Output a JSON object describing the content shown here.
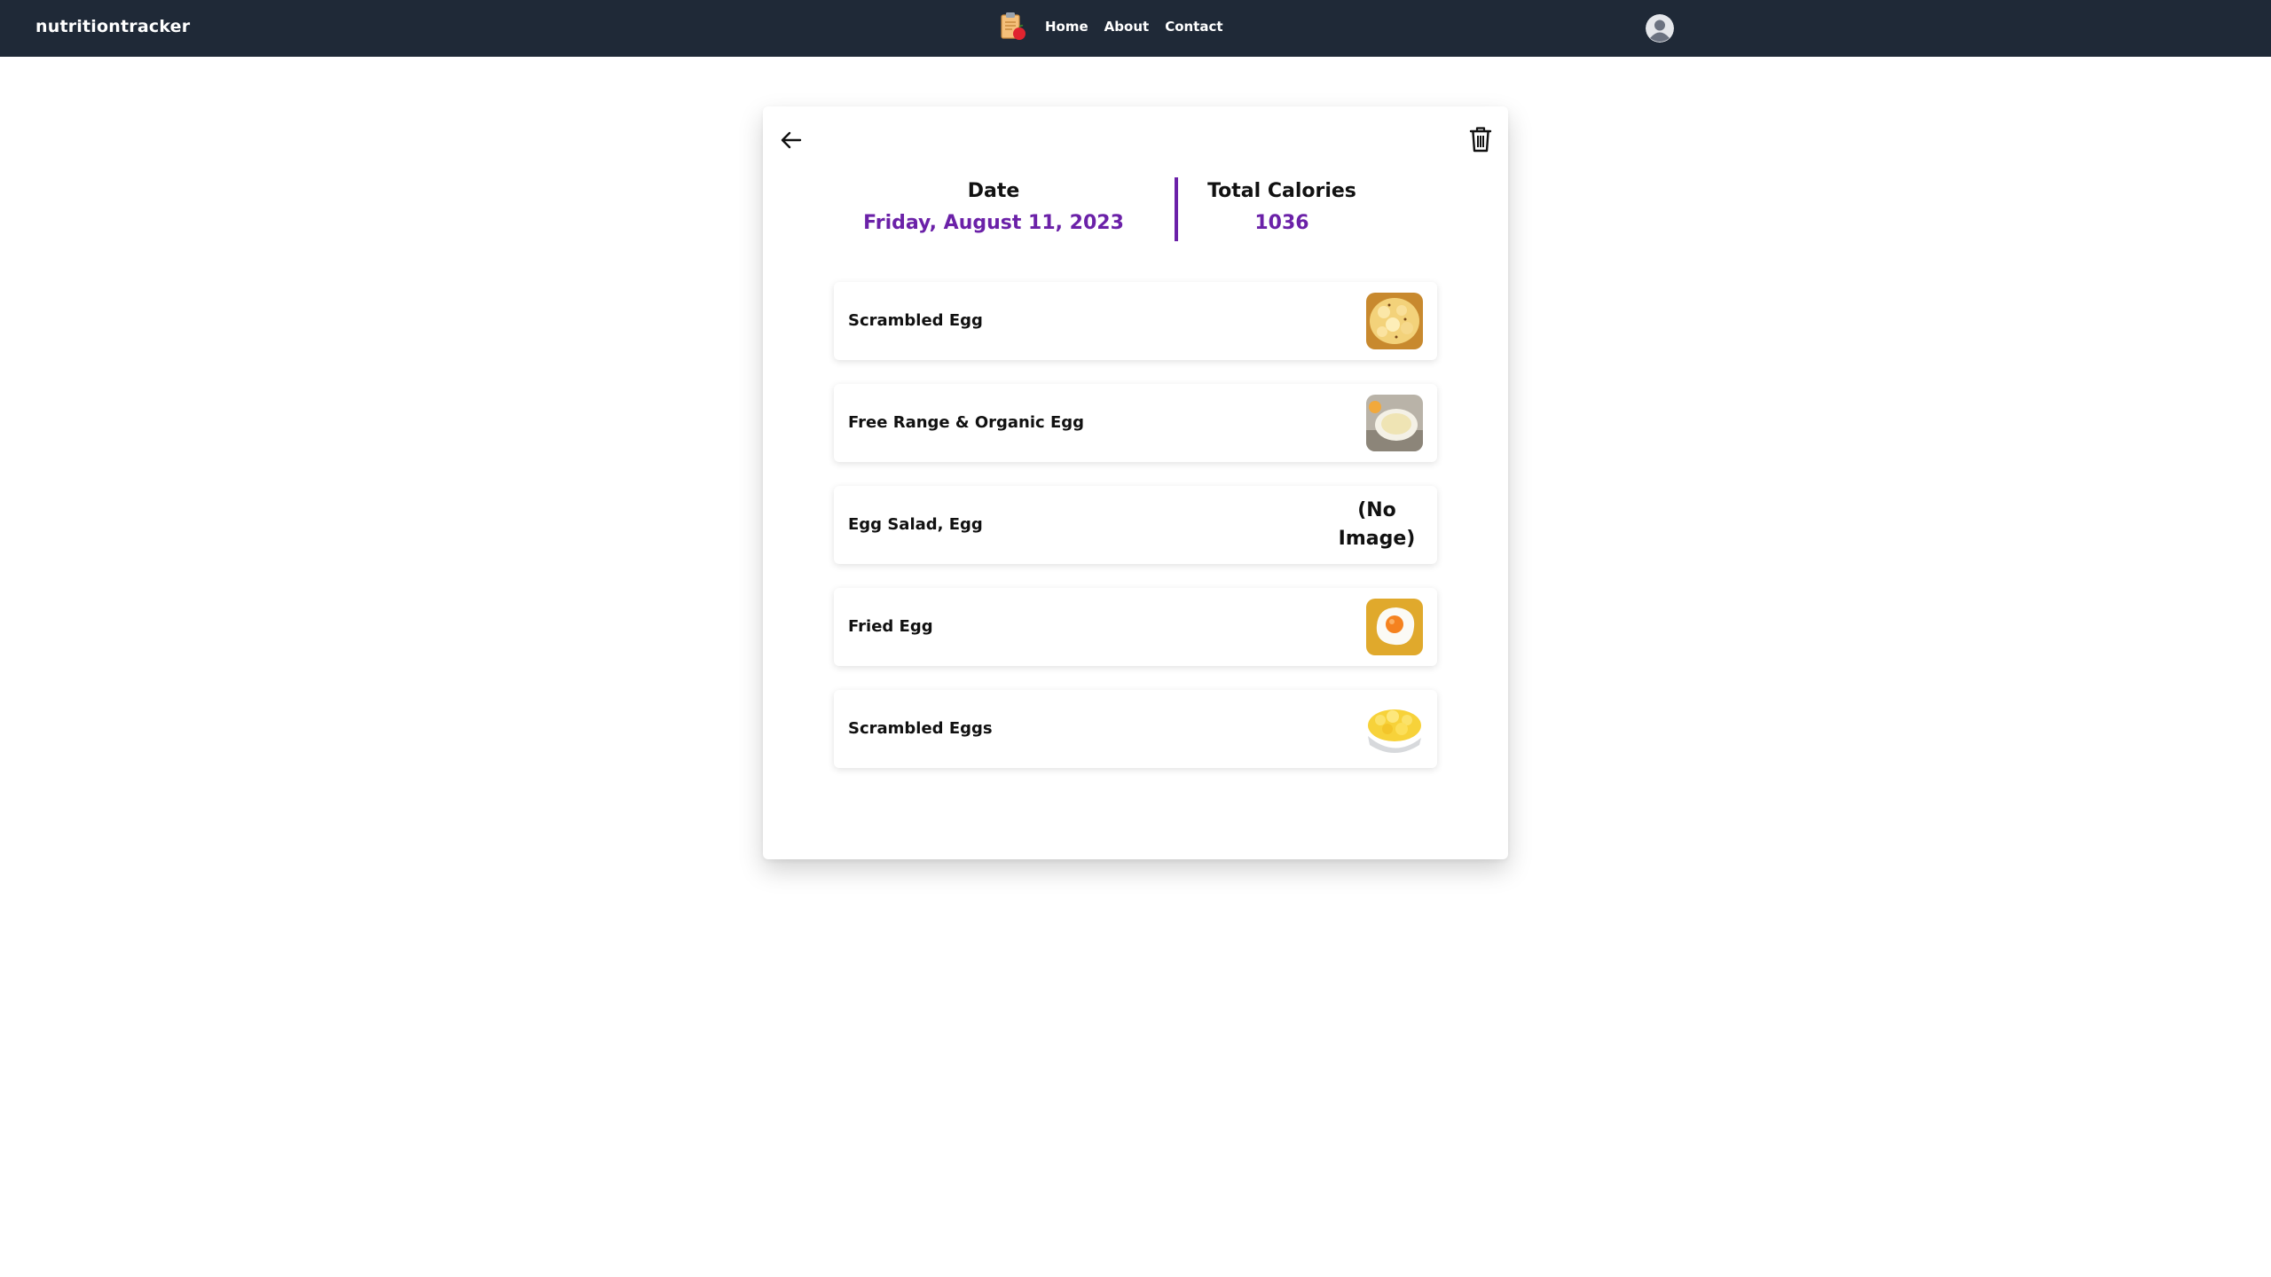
{
  "navbar": {
    "brand": "nutritiontracker",
    "links": [
      {
        "label": "Home"
      },
      {
        "label": "About"
      },
      {
        "label": "Contact"
      }
    ]
  },
  "summary": {
    "date_label": "Date",
    "date_value": "Friday, August 11, 2023",
    "calories_label": "Total Calories",
    "calories_value": "1036"
  },
  "foods": [
    {
      "name": "Scrambled Egg",
      "image": "scrambled-egg-photo"
    },
    {
      "name": "Free Range & Organic Egg",
      "image": "organic-egg-photo"
    },
    {
      "name": "Egg Salad, Egg",
      "image_text": "(No Image)"
    },
    {
      "name": "Fried Egg",
      "image": "fried-egg-photo"
    },
    {
      "name": "Scrambled Eggs",
      "image": "scrambled-eggs-photo"
    }
  ],
  "colors": {
    "navbar_bg": "#1f2937",
    "accent": "#6b21a8"
  },
  "icons": {
    "back": "arrow-left-icon",
    "delete": "trash-icon",
    "logo": "clipboard-apple-icon",
    "user": "user-avatar-icon"
  }
}
